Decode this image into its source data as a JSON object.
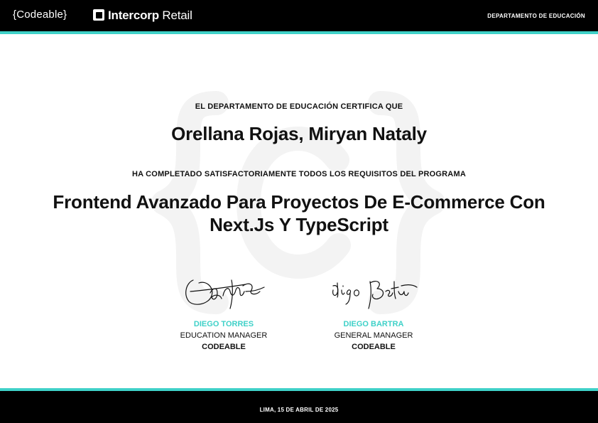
{
  "header": {
    "logo_codeable": "{Codeable}",
    "logo_intercorp_bold": "Intercorp",
    "logo_intercorp_light": "Retail",
    "department": "DEPARTAMENTO DE EDUCACIÓN"
  },
  "certificate": {
    "certifies_text": "EL DEPARTAMENTO DE EDUCACIÓN CERTIFICA QUE",
    "recipient_name": "Orellana Rojas, Miryan Nataly",
    "completed_text": "HA COMPLETADO SATISFACTORIAMENTE TODOS LOS REQUISITOS DEL PROGRAMA",
    "program_line_1": "Frontend Avanzado Para Proyectos De E-Commerce Con",
    "program_line_2": "Next.Js Y TypeScript"
  },
  "signers": [
    {
      "name": "DIEGO TORRES",
      "role": "EDUCATION MANAGER",
      "organization": "CODEABLE"
    },
    {
      "name": "DIEGO BARTRA",
      "role": "GENERAL MANAGER",
      "organization": "CODEABLE"
    }
  ],
  "footer": {
    "date": "LIMA, 15 DE ABRIL DE 2025"
  },
  "colors": {
    "accent": "#3fd1c8",
    "bar": "#000000",
    "watermark": "#f3f3f3"
  },
  "icons": {
    "intercorp_logo": "intercorp-logo-icon",
    "watermark": "codeable-watermark-icon"
  }
}
